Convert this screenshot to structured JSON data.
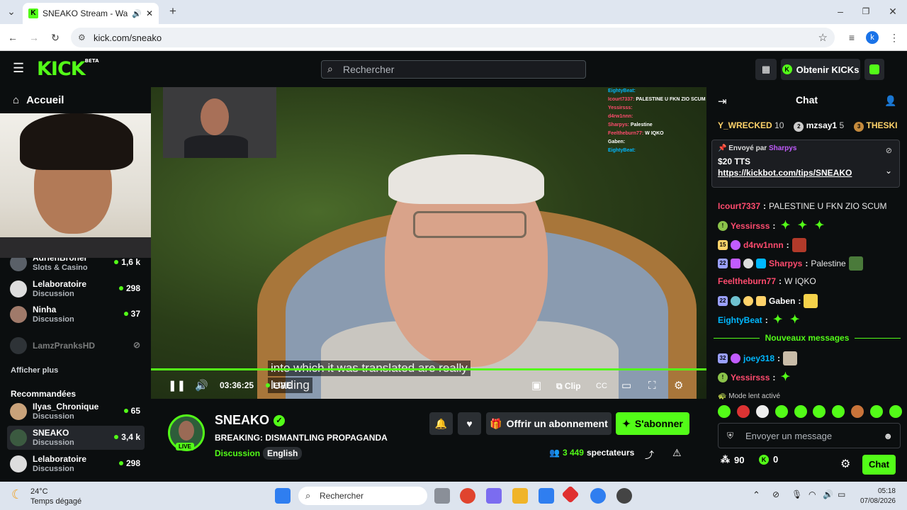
{
  "browser": {
    "tab_title": "SNEAKO Stream - Watch Li",
    "url": "kick.com/sneako",
    "profile_letter": "k"
  },
  "header": {
    "logo": "KICK",
    "logo_beta": "BETA",
    "search_placeholder": "Rechercher",
    "get_kicks": "Obtenir KICKs"
  },
  "sidebar": {
    "home": "Accueil",
    "following": [
      {
        "name": "AdrienBroner",
        "category": "Slots & Casino",
        "viewers": "1,6 k"
      },
      {
        "name": "Lelaboratoire",
        "category": "Discussion",
        "viewers": "298"
      },
      {
        "name": "Ninha",
        "category": "Discussion",
        "viewers": "37"
      },
      {
        "name": "LamzPranksHD",
        "category": "",
        "viewers": ""
      }
    ],
    "show_more": "Afficher plus",
    "recommended_title": "Recommandées",
    "recommended": [
      {
        "name": "Ilyas_Chronique",
        "category": "Discussion",
        "viewers": "65"
      },
      {
        "name": "SNEAKO",
        "category": "Discussion",
        "viewers": "3,4 k"
      },
      {
        "name": "Lelaboratoire",
        "category": "Discussion",
        "viewers": "298"
      }
    ]
  },
  "player": {
    "subtitle_line1": "into which it was translated are really",
    "subtitle_line2": "leading",
    "time": "03:36:25",
    "live": "LIVE",
    "clip": "Clip",
    "progress": 1.0,
    "overlay_chat": [
      {
        "user": "EightyBeat:",
        "text": ""
      },
      {
        "user": "Icourt7337:",
        "text": "PALESTINE U FKN ZIO SCUM"
      },
      {
        "user": "Yessirsss:",
        "text": ""
      },
      {
        "user": "d4rw1nnn:",
        "text": ""
      },
      {
        "user": "Sharpys:",
        "text": "Palestine"
      },
      {
        "user": "Feeltheburn77:",
        "text": "W IQKO"
      },
      {
        "user": "Gaben:",
        "text": ""
      },
      {
        "user": "EightyBeat:",
        "text": ""
      }
    ]
  },
  "stream": {
    "channel": "SNEAKO",
    "live_badge": "LIVE",
    "title": "BREAKING: DISMANTLING PROPAGANDA",
    "category": "Discussion",
    "language": "English",
    "subscribe_gift": "Offrir un abonnement",
    "subscribe": "S'abonner",
    "viewers_count": "3 449",
    "viewers_label": "spectateurs"
  },
  "chat": {
    "title": "Chat",
    "leaderboard": [
      {
        "rank": "",
        "name": "Y_WRECKED",
        "count": "10"
      },
      {
        "rank": "2",
        "name": "mzsay1",
        "count": "5"
      },
      {
        "rank": "3",
        "name": "THESKI",
        "count": ""
      }
    ],
    "pinned": {
      "sent_by": "Envoyé par",
      "user": "Sharpys",
      "amount": "$20 TTS",
      "link": "https://kickbot.com/tips/SNEAKO"
    },
    "messages": [
      {
        "user": "Icourt7337",
        "color": "#ff4b6e",
        "text": "PALESTINE U FKN ZIO SCUM"
      },
      {
        "user": "Yessirsss",
        "color": "#ff4b6e",
        "text": ""
      },
      {
        "user": "d4rw1nnn",
        "color": "#ff4b6e",
        "text": ""
      },
      {
        "user": "Sharpys",
        "color": "#ff4b6e",
        "text": "Palestine"
      },
      {
        "user": "Feeltheburn77",
        "color": "#ff4b6e",
        "text": "W IQKO"
      },
      {
        "user": "Gaben",
        "color": "#ffffff",
        "text": ""
      },
      {
        "user": "EightyBeat",
        "color": "#00b8ff",
        "text": ""
      }
    ],
    "new_messages": "Nouveaux messages",
    "after_messages": [
      {
        "user": "joey318",
        "color": "#00b8ff",
        "text": ""
      },
      {
        "user": "Yessirsss",
        "color": "#ff4b6e",
        "text": ""
      }
    ],
    "badge_15": "15",
    "badge_22": "22",
    "badge_32": "32",
    "slow_mode": "Mode lent activé",
    "input_placeholder": "Envoyer un message",
    "points": "90",
    "kicks": "0",
    "send": "Chat"
  },
  "taskbar": {
    "temp": "24°C",
    "weather": "Temps dégagé",
    "search": "Rechercher",
    "time": "05:18",
    "date": "07/08/2026"
  }
}
